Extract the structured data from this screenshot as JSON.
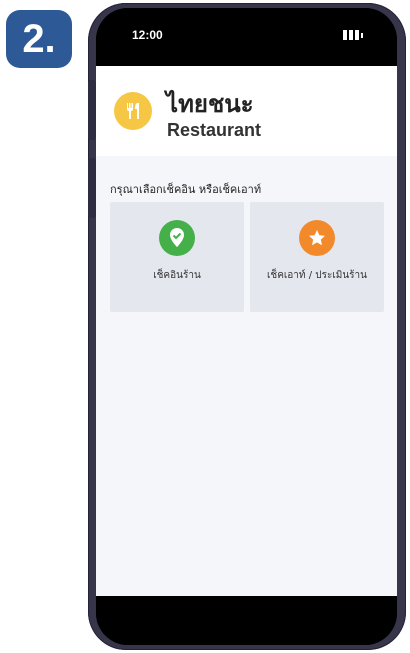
{
  "step": {
    "label": "2."
  },
  "status_bar": {
    "time": "12:00"
  },
  "app": {
    "title_th": "ไทยชนะ",
    "title_en": "Restaurant",
    "logo_icon": "fork-knife-icon",
    "prompt": "กรุณาเลือกเช็คอิน หรือเช็คเอาท์"
  },
  "cards": [
    {
      "icon": "location-check-icon",
      "color": "#45b04a",
      "label": "เช็คอินร้าน"
    },
    {
      "icon": "star-icon",
      "color": "#f28a2c",
      "label": "เช็คเอาท์ / ประเมินร้าน"
    }
  ],
  "colors": {
    "badge": "#2d5a96",
    "frame": "#37354a",
    "card_bg": "#e4e7ee",
    "logo_bg": "#f6c744"
  }
}
